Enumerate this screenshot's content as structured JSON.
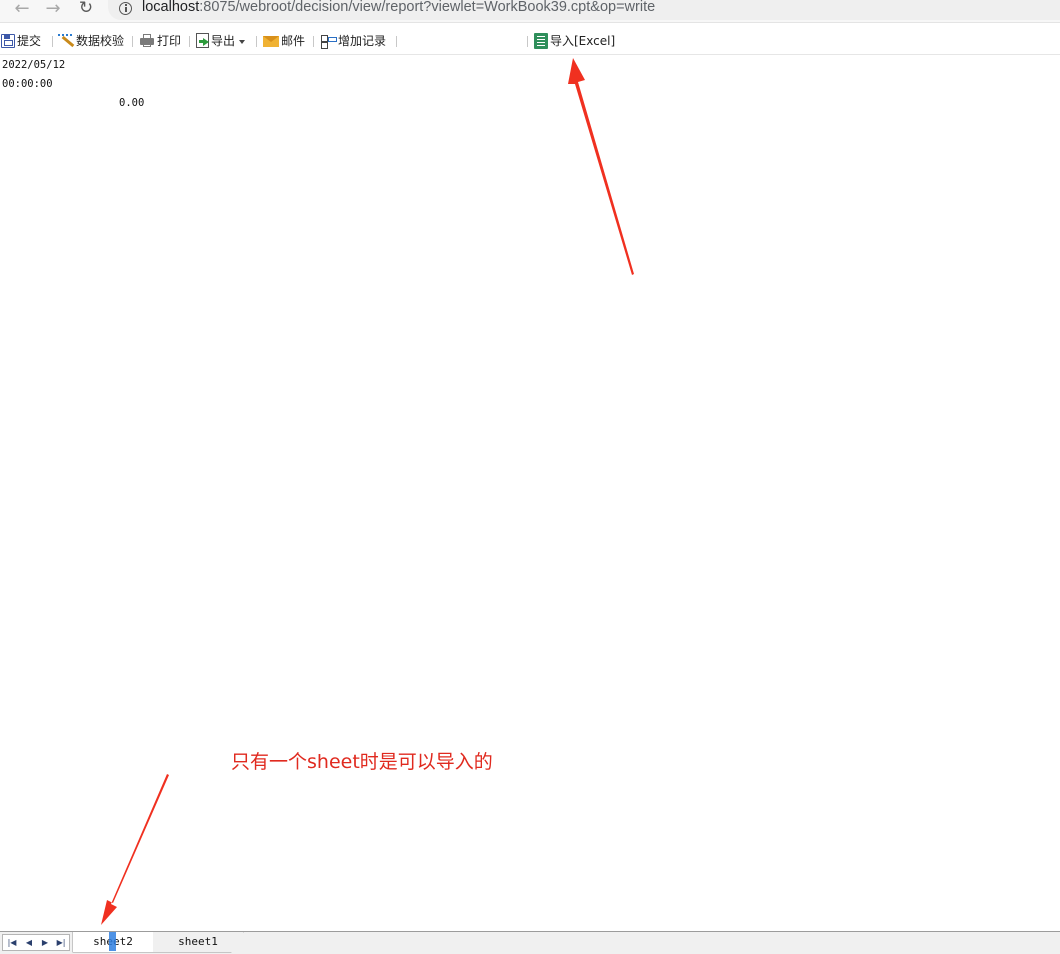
{
  "browser": {
    "url_host": "localhost",
    "url_rest": ":8075/webroot/decision/view/report?viewlet=WorkBook39.cpt&op=write"
  },
  "toolbar": {
    "submit": "提交",
    "validate": "数据校验",
    "print": "打印",
    "export": "导出",
    "mail": "邮件",
    "add_record": "增加记录",
    "import_excel": "导入[Excel]"
  },
  "report": {
    "date": "2022/05/12",
    "time": "00:00:00",
    "amount": "0.00"
  },
  "annotation": {
    "text": "只有一个sheet时是可以导入的",
    "color": "#e02a1f"
  },
  "sheets": {
    "tabs": [
      "sheet2",
      "sheet1"
    ],
    "active": "sheet2"
  },
  "icons": {
    "submit": "save-icon",
    "validate": "magic-wand-icon",
    "print": "printer-icon",
    "export": "export-icon",
    "mail": "mail-icon",
    "add_record": "add-record-icon",
    "import_excel": "excel-icon"
  }
}
